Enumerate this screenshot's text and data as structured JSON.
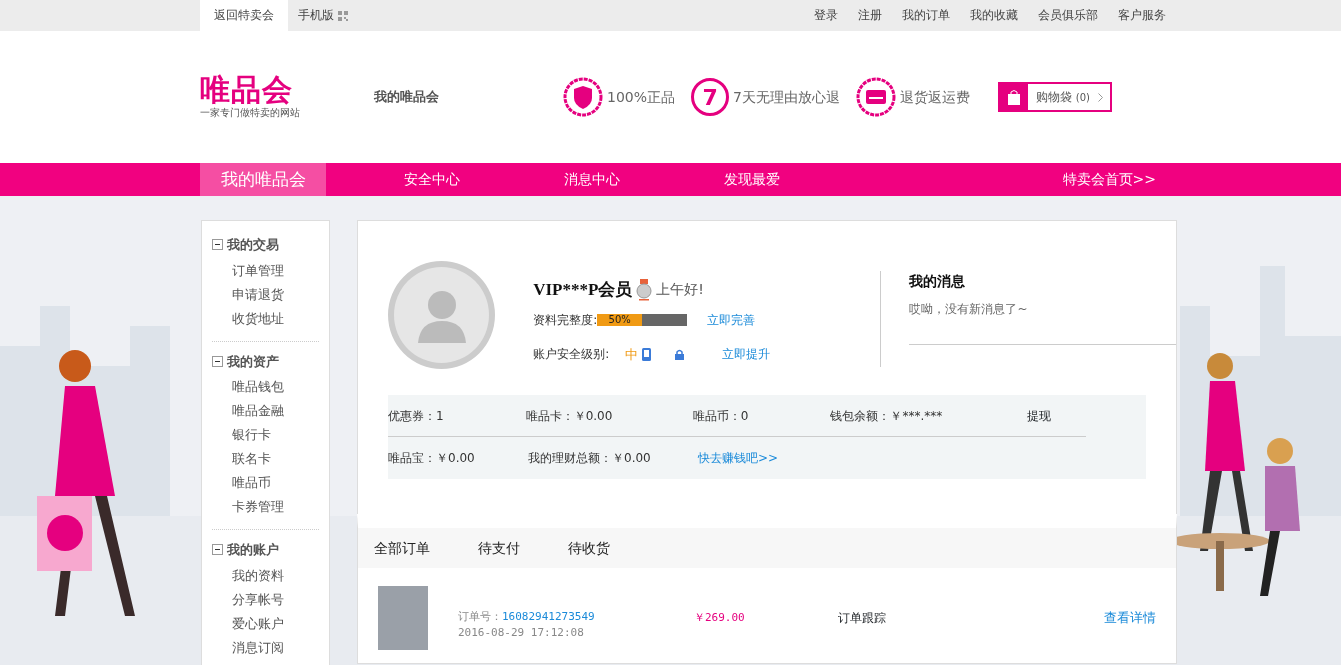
{
  "topbar": {
    "left": [
      {
        "label": "返回特卖会",
        "selected": true,
        "qr": false
      },
      {
        "label": "手机版",
        "selected": false,
        "qr": true
      }
    ],
    "right": [
      "登录",
      "注册",
      "我的订单",
      "我的收藏",
      "会员俱乐部",
      "客户服务"
    ]
  },
  "header": {
    "logo": "唯品会",
    "tagline": "一家专门做特卖的网站",
    "page_title": "我的唯品会",
    "promises": [
      {
        "kind": "shield",
        "text": "100%正品"
      },
      {
        "kind": "number",
        "icon_text": "7",
        "text": "7天无理由放心退"
      },
      {
        "kind": "card",
        "text": "退货返运费"
      }
    ],
    "cart": {
      "label": "购物袋",
      "count": "(0)"
    }
  },
  "nav": {
    "items": [
      {
        "label": "我的唯品会",
        "selected": true
      },
      {
        "label": "安全中心",
        "selected": false
      },
      {
        "label": "消息中心",
        "selected": false
      },
      {
        "label": "发现最爱",
        "selected": false
      }
    ],
    "home_link": "特卖会首页>>"
  },
  "sidebar": {
    "sections": [
      {
        "title": "我的交易",
        "expanded": true,
        "items": [
          "订单管理",
          "申请退货",
          "收货地址"
        ]
      },
      {
        "title": "我的资产",
        "expanded": true,
        "items": [
          "唯品钱包",
          "唯品金融",
          "银行卡",
          "联名卡",
          "唯品币",
          "卡券管理"
        ]
      },
      {
        "title": "我的账户",
        "expanded": true,
        "items": [
          "我的资料",
          "分享帐号",
          "爱心账户",
          "消息订阅"
        ]
      }
    ]
  },
  "profile": {
    "name": "VIP***P会员",
    "greeting": "上午好!",
    "completeness": {
      "label": "资料完整度:",
      "level": 0.5,
      "reading": "50%",
      "link": "立即完善"
    },
    "security": {
      "label": "账户安全级别:",
      "rating": "中",
      "link": "立即提升"
    }
  },
  "messages": {
    "title": "我的消息",
    "text": "哎呦，没有新消息了~"
  },
  "assets": {
    "rows": [
      [
        {
          "kind": "text",
          "text": "优惠券：1"
        },
        {
          "kind": "text",
          "text": "唯品卡：￥0.00"
        },
        {
          "kind": "text",
          "text": "唯品币：0"
        },
        {
          "kind": "text",
          "text": "钱包余额：￥***.***"
        },
        {
          "kind": "link",
          "text": "提现"
        }
      ],
      [
        {
          "kind": "text",
          "text": "唯品宝：￥0.00"
        },
        {
          "kind": "text",
          "text": "我的理财总额：￥0.00"
        },
        {
          "kind": "link",
          "text": "快去赚钱吧>>"
        }
      ]
    ]
  },
  "orders": {
    "tabs": [
      "全部订单",
      "待支付",
      "待收货"
    ],
    "rows": [
      {
        "number_label": "订单号：",
        "number": "16082941273549",
        "time": "2016-08-29 17:12:08",
        "price": "￥269.00",
        "track": "订单跟踪",
        "detail": "查看详情"
      }
    ]
  }
}
